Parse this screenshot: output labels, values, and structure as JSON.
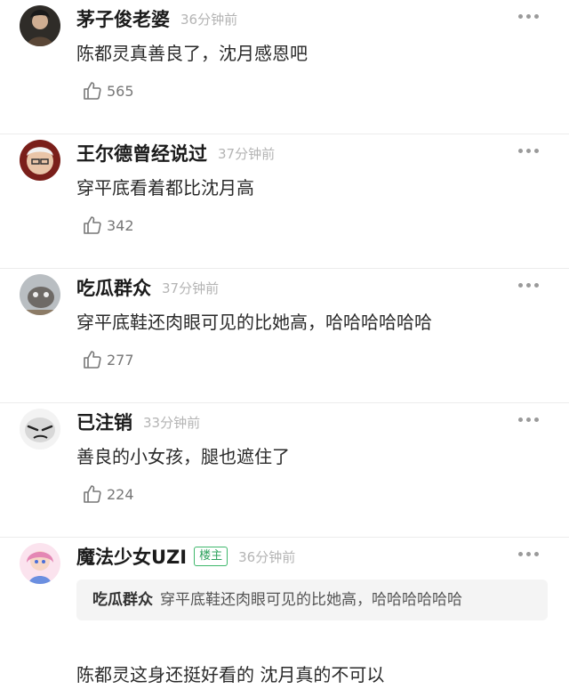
{
  "comments": [
    {
      "username": "茅子俊老婆",
      "time": "36分钟前",
      "text": "陈都灵真善良了，沈月感恩吧",
      "likes": "565",
      "avatar_color": "#3b3a35"
    },
    {
      "username": "王尔德曾经说过",
      "time": "37分钟前",
      "text": "穿平底看着都比沈月高",
      "likes": "342",
      "avatar_color": "#8a2b25"
    },
    {
      "username": "吃瓜群众",
      "time": "37分钟前",
      "text": "穿平底鞋还肉眼可见的比她高，哈哈哈哈哈哈",
      "likes": "277",
      "avatar_color": "#9aa1a6"
    },
    {
      "username": "已注销",
      "time": "33分钟前",
      "text": "善良的小女孩，腿也遮住了",
      "likes": "224",
      "avatar_color": "#d9d9d9"
    }
  ],
  "last_comment": {
    "username": "魔法少女UZI",
    "badge": "楼主",
    "time": "36分钟前",
    "quote_user": "吃瓜群众",
    "quote_text": "穿平底鞋还肉眼可见的比她高，哈哈哈哈哈哈",
    "text": "陈都灵这身还挺好看的 沈月真的不可以",
    "avatar_color": "#e8b7cf"
  },
  "icons": {
    "like": "thumbs-up-icon",
    "more": "more-dots-icon"
  }
}
